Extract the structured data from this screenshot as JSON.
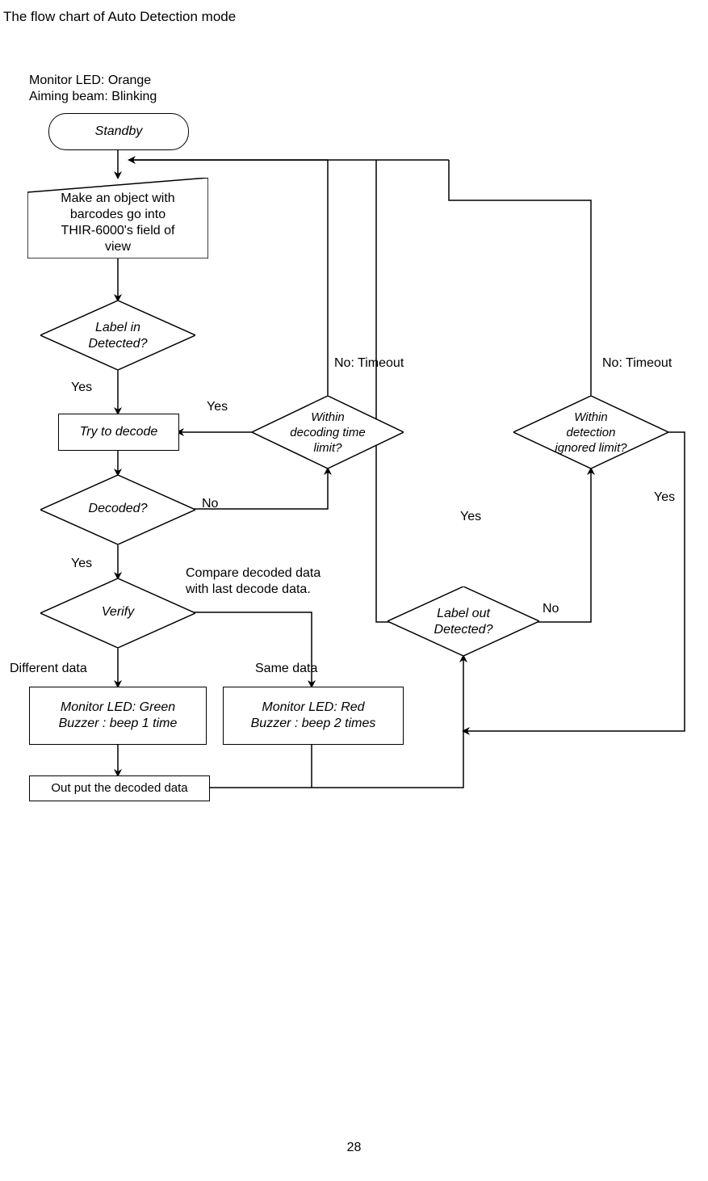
{
  "title": "The flow chart of Auto Detection mode",
  "subtitle": {
    "line1": "Monitor LED: Orange",
    "line2": "Aiming beam: Blinking"
  },
  "nodes": {
    "standby": "Standby",
    "make_object": "Make an object with\nbarcodes go into\nTHIR-6000's field of\nview",
    "label_in": "Label in\nDetected?",
    "try_decode": "Try to decode",
    "within_decoding": "Within\ndecoding time\nlimit?",
    "decoded": "Decoded?",
    "verify": "Verify",
    "led_green": "Monitor LED: Green\nBuzzer : beep 1 time",
    "led_red": "Monitor LED: Red\nBuzzer : beep 2 times",
    "output": "Out put the decoded data",
    "label_out": "Label out\nDetected?",
    "within_detection": "Within\ndetection\nignored limit?"
  },
  "labels": {
    "yes": "Yes",
    "no": "No",
    "no_timeout": "No: Timeout",
    "same_data": "Same data",
    "different_data": "Different data",
    "compare": "Compare decoded data\nwith last decode data."
  },
  "page_number": "28"
}
